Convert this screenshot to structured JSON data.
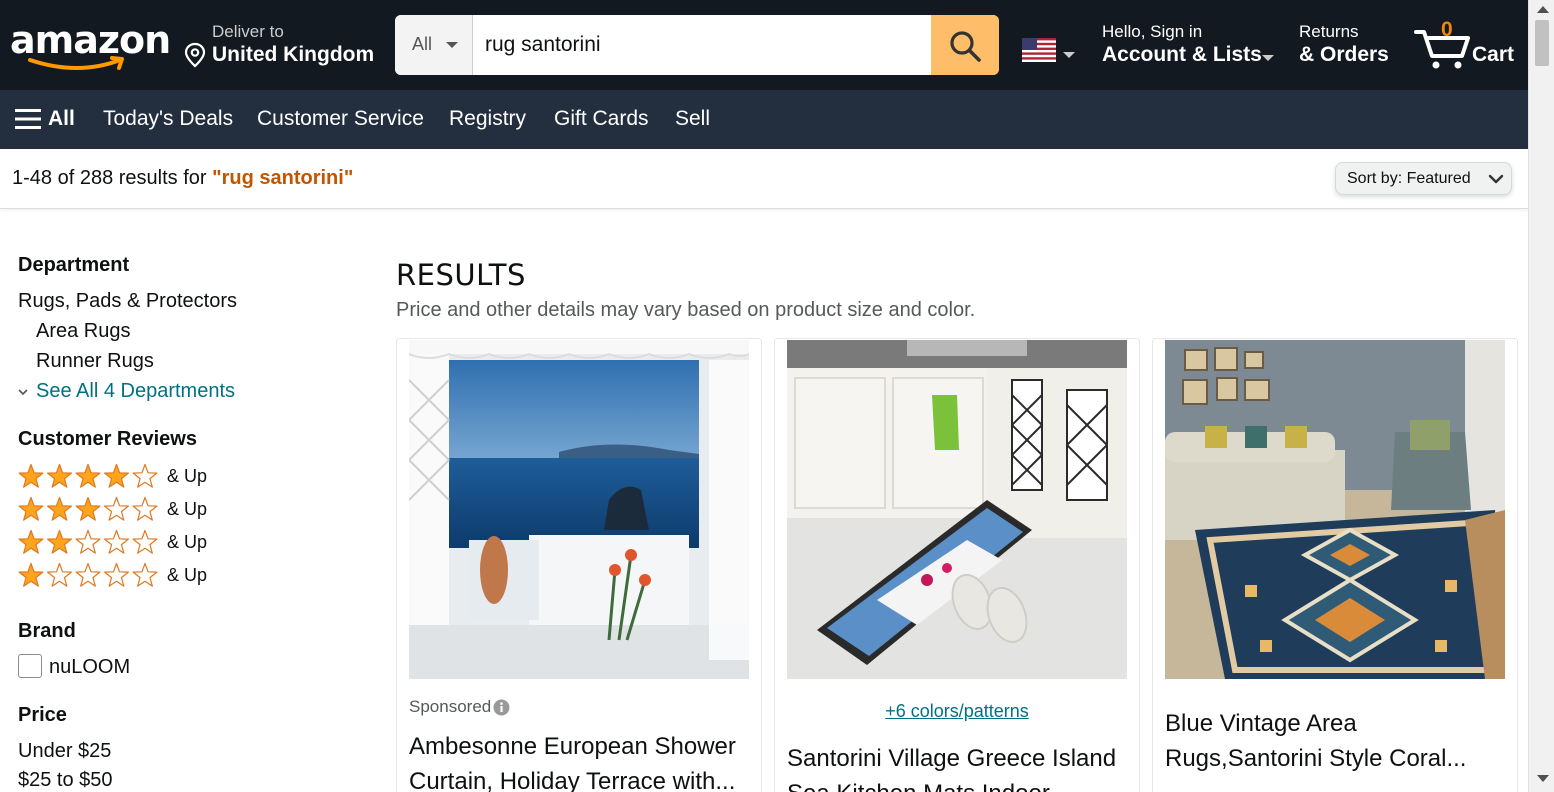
{
  "header": {
    "logo_text": "amazon",
    "deliver": {
      "line1": "Deliver to",
      "line2": "United Kingdom"
    },
    "search": {
      "category": "All",
      "value": "rug santorini"
    },
    "account": {
      "line1": "Hello, Sign in",
      "line2": "Account & Lists"
    },
    "returns": {
      "line1": "Returns",
      "line2": "& Orders"
    },
    "cart": {
      "count": "0",
      "label": "Cart"
    }
  },
  "subnav": {
    "all_label": "All",
    "links": [
      "Today's Deals",
      "Customer Service",
      "Registry",
      "Gift Cards",
      "Sell"
    ]
  },
  "results_bar": {
    "count_text": "1-48 of 288 results for ",
    "query": "\"rug santorini\"",
    "sort_label": "Sort by:  Featured"
  },
  "sidebar": {
    "department": {
      "heading": "Department",
      "top": "Rugs, Pads & Protectors",
      "children": [
        "Area Rugs",
        "Runner Rugs"
      ],
      "see_all": "See All 4 Departments"
    },
    "reviews": {
      "heading": "Customer Reviews",
      "rows": [
        {
          "stars": 4,
          "label": "& Up"
        },
        {
          "stars": 3,
          "label": "& Up"
        },
        {
          "stars": 2,
          "label": "& Up"
        },
        {
          "stars": 1,
          "label": "& Up"
        }
      ]
    },
    "brand": {
      "heading": "Brand",
      "options": [
        "nuLOOM"
      ]
    },
    "price": {
      "heading": "Price",
      "options": [
        "Under $25",
        "$25 to $50"
      ]
    }
  },
  "main": {
    "title": "RESULTS",
    "subtitle": "Price and other details may vary based on product size and color.",
    "products": [
      {
        "sponsored": "Sponsored",
        "title_line1": "Ambesonne European Shower",
        "title_line2": "Curtain, Holiday Terrace with..."
      },
      {
        "colors": "+6 colors/patterns",
        "title_line1": "Santorini Village Greece Island",
        "title_line2": "Sea Kitchen Mats Indoor"
      },
      {
        "title_line1": "Blue Vintage Area",
        "title_line2": "Rugs,Santorini Style Coral..."
      }
    ]
  },
  "colors": {
    "nav_dark": "#131921",
    "nav_sub": "#232f3e",
    "search_button": "#febd69",
    "link": "#007185",
    "query": "#c45500",
    "star": "#ffa41c"
  }
}
